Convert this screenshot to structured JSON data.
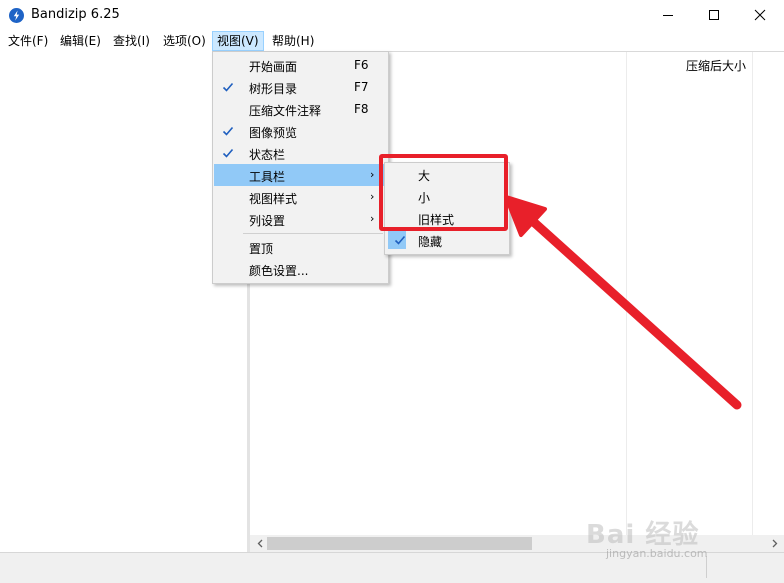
{
  "window": {
    "title": "Bandizip 6.25",
    "icon": "bandizip-logo-icon"
  },
  "menubar": {
    "items": [
      "文件(F)",
      "编辑(E)",
      "查找(I)",
      "选项(O)",
      "视图(V)",
      "帮助(H)"
    ],
    "active": "视图(V)"
  },
  "file_list": {
    "column_header": "压缩后大小"
  },
  "view_menu": {
    "items": [
      {
        "label": "开始画面",
        "shortcut": "F6",
        "checked": false
      },
      {
        "label": "树形目录",
        "shortcut": "F7",
        "checked": true
      },
      {
        "label": "压缩文件注释",
        "shortcut": "F8",
        "checked": false
      },
      {
        "label": "图像预览",
        "shortcut": "",
        "checked": true
      },
      {
        "label": "状态栏",
        "shortcut": "",
        "checked": true
      },
      {
        "label": "工具栏",
        "submenu": true,
        "highlighted": true
      },
      {
        "label": "视图样式",
        "submenu": true
      },
      {
        "label": "列设置",
        "submenu": true
      },
      {
        "label": "置顶"
      },
      {
        "label": "颜色设置..."
      }
    ]
  },
  "toolbar_submenu": {
    "items": [
      {
        "label": "大",
        "checked": false
      },
      {
        "label": "小",
        "checked": false
      },
      {
        "label": "旧样式",
        "checked": false
      },
      {
        "label": "隐藏",
        "checked": true
      }
    ]
  },
  "annotation": {
    "color": "#e8202a"
  },
  "watermark": {
    "text": "Bai 经验",
    "url": "jingyan.baidu.com"
  },
  "colors": {
    "menu_highlight": "#91c9f7",
    "accent": "#1e63c6"
  }
}
